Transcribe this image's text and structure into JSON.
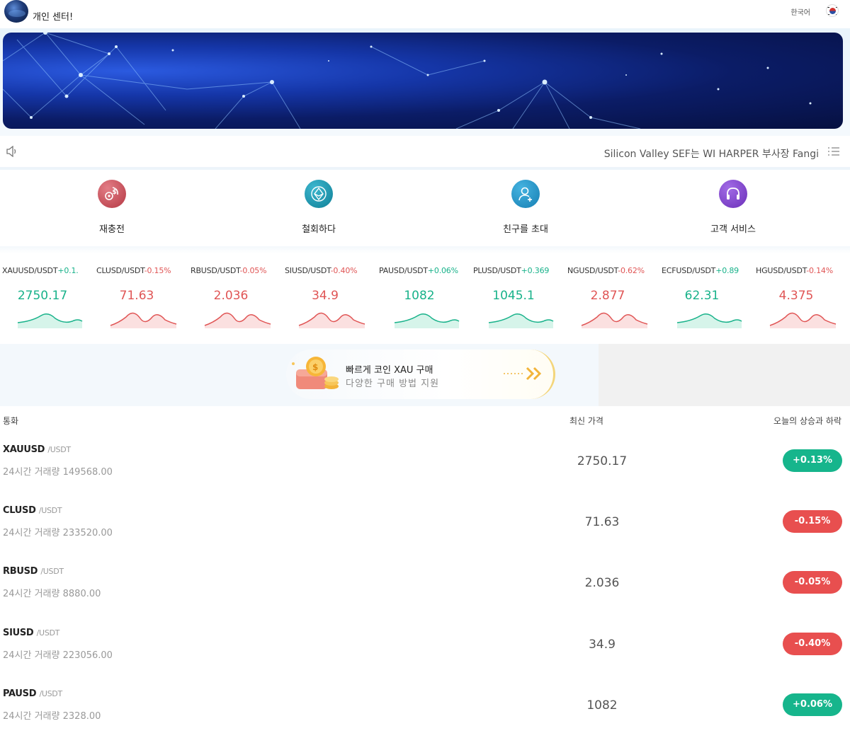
{
  "header": {
    "user_center": "개인 센터!",
    "language": "한국어",
    "flag_icon": "korea-flag-icon"
  },
  "notice": {
    "text": "Silicon Valley SEF는 WI HARPER 부사장 Fangi"
  },
  "actions": [
    {
      "label": "재충전",
      "icon": "recharge-icon",
      "color": "#c8464f"
    },
    {
      "label": "철회하다",
      "icon": "withdraw-icon",
      "color": "#1d8fa8"
    },
    {
      "label": "친구를 초대",
      "icon": "invite-friend-icon",
      "color": "#1f8fbf"
    },
    {
      "label": "고객 서비스",
      "icon": "customer-service-icon",
      "color": "#7b3fc4"
    }
  ],
  "tickers": [
    {
      "pair": "XAUUSD/USDT",
      "change": "+0.1.",
      "price": "2750.17",
      "trend": "up"
    },
    {
      "pair": "CLUSD/USDT",
      "change": "-0.15%",
      "price": "71.63",
      "trend": "down"
    },
    {
      "pair": "RBUSD/USDT",
      "change": "-0.05%",
      "price": "2.036",
      "trend": "down"
    },
    {
      "pair": "SIUSD/USDT",
      "change": "-0.40%",
      "price": "34.9",
      "trend": "down"
    },
    {
      "pair": "PAUSD/USDT",
      "change": "+0.06%",
      "price": "1082",
      "trend": "up"
    },
    {
      "pair": "PLUSD/USDT",
      "change": "+0.369",
      "price": "1045.1",
      "trend": "up"
    },
    {
      "pair": "NGUSD/USDT",
      "change": "-0.62%",
      "price": "2.877",
      "trend": "down"
    },
    {
      "pair": "ECFUSD/USDT",
      "change": "+0.89",
      "price": "62.31",
      "trend": "up"
    },
    {
      "pair": "HGUSD/USDT",
      "change": "-0.14%",
      "price": "4.375",
      "trend": "down"
    }
  ],
  "promo": {
    "title": "빠르게 코인 XAU 구매",
    "subtitle": "다양한 구매 방법 지원"
  },
  "table": {
    "col_currency": "통화",
    "col_price": "최신 가격",
    "col_change": "오늘의 상승과 하락",
    "volume_label": "24시간 거래량",
    "rows": [
      {
        "symbol": "XAUUSD",
        "quote": "/USDT",
        "volume": "149568.00",
        "price": "2750.17",
        "change": "+0.13%",
        "trend": "up"
      },
      {
        "symbol": "CLUSD",
        "quote": "/USDT",
        "volume": "233520.00",
        "price": "71.63",
        "change": "-0.15%",
        "trend": "down"
      },
      {
        "symbol": "RBUSD",
        "quote": "/USDT",
        "volume": "8880.00",
        "price": "2.036",
        "change": "-0.05%",
        "trend": "down"
      },
      {
        "symbol": "SIUSD",
        "quote": "/USDT",
        "volume": "223056.00",
        "price": "34.9",
        "change": "-0.40%",
        "trend": "down"
      },
      {
        "symbol": "PAUSD",
        "quote": "/USDT",
        "volume": "2328.00",
        "price": "1082",
        "change": "+0.06%",
        "trend": "up"
      }
    ]
  },
  "colors": {
    "up": "#18b28a",
    "down": "#e05555"
  }
}
